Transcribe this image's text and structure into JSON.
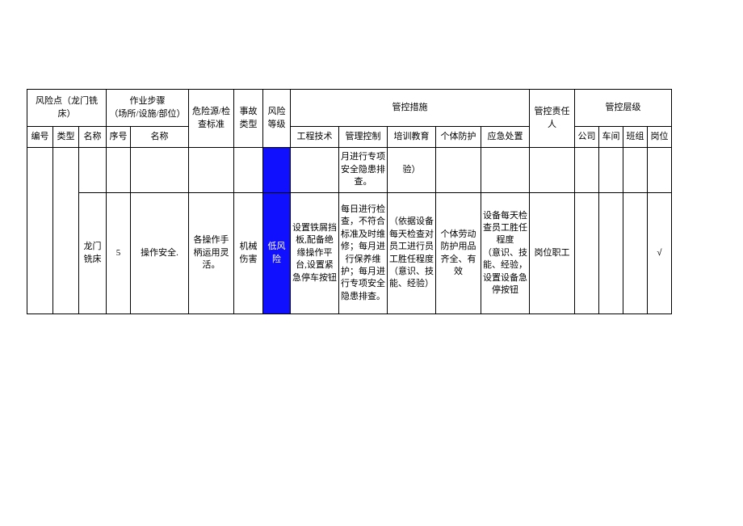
{
  "headers": {
    "risk_point": "风险点（龙门铣床）",
    "work_step": "作业步骤\n（场所/设施/部位）",
    "hazard_std": "危险源/检查标准",
    "accident_type": "事故类型",
    "risk_level": "风险等级",
    "control_measures": "管控措施",
    "responsible": "管控责任人",
    "control_level": "管控层级",
    "sub": {
      "id": "编号",
      "type": "类型",
      "name": "名称",
      "seq": "序号",
      "step_name": "名称",
      "eng_tech": "工程技术",
      "mgmt_ctrl": "管理控制",
      "training": "培训教育",
      "ppe": "个体防护",
      "emergency": "应急处置",
      "company": "公司",
      "workshop": "车间",
      "team": "班组",
      "post": "岗位"
    }
  },
  "rows": [
    {
      "id": "",
      "type": "",
      "name_top": "",
      "seq": "",
      "step_name": "",
      "hazard": "",
      "accident": "",
      "risk": "",
      "eng": "",
      "mgmt": "月进行专项安全隐患排查。",
      "training": "验）",
      "ppe": "",
      "emergency": "",
      "responsible": "",
      "company": "",
      "workshop": "",
      "team": "",
      "post": ""
    },
    {
      "name": "龙门铣床",
      "seq": "5",
      "step_name": "操作安全.",
      "hazard": "各操作手柄运用灵活。",
      "accident": "机械伤害",
      "risk": "低风险",
      "eng": "设置铁屑挡板,配备绝缘操作平台,设置紧急停车按钮",
      "mgmt": "每日进行检查，不符合标准及时维修；每月进行保养维护；每月进行专项安全隐患排查。",
      "training": "（依据设备每天检查对员工进行员工胜任程度\n（意识、技能、经验）",
      "ppe": "个体劳动防护用品齐全、有效",
      "emergency": "设备每天检查员工胜任程度\n（意识、技能、经验，设置设备急停按钮",
      "responsible": "岗位职工",
      "company": "",
      "workshop": "",
      "team": "",
      "post": "√"
    }
  ]
}
